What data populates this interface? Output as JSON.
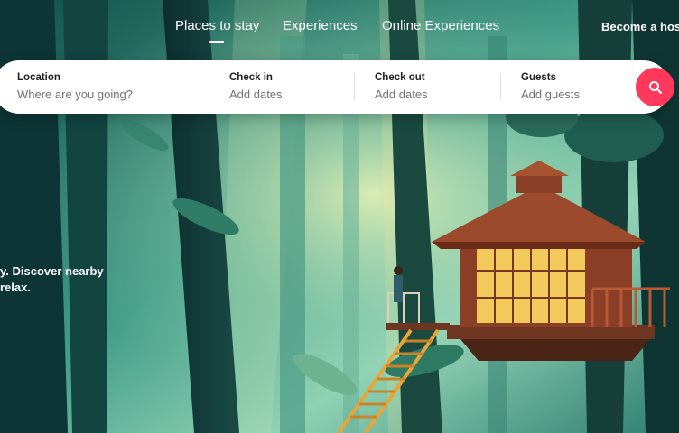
{
  "nav": {
    "items": [
      {
        "label": "Places to stay",
        "active": true
      },
      {
        "label": "Experiences",
        "active": false
      },
      {
        "label": "Online Experiences",
        "active": false
      }
    ],
    "host_link": "Become a host"
  },
  "search": {
    "location": {
      "label": "Location",
      "placeholder": "Where are you going?"
    },
    "check_in": {
      "label": "Check in",
      "placeholder": "Add dates"
    },
    "check_out": {
      "label": "Check out",
      "placeholder": "Add dates"
    },
    "guests": {
      "label": "Guests",
      "placeholder": "Add guests"
    },
    "button_icon": "search-icon"
  },
  "hero": {
    "tagline_line1": "y. Discover nearby",
    "tagline_line2": "relax."
  },
  "colors": {
    "accent": "#ff385c",
    "text_dark": "#222222",
    "text_muted": "#717171"
  }
}
